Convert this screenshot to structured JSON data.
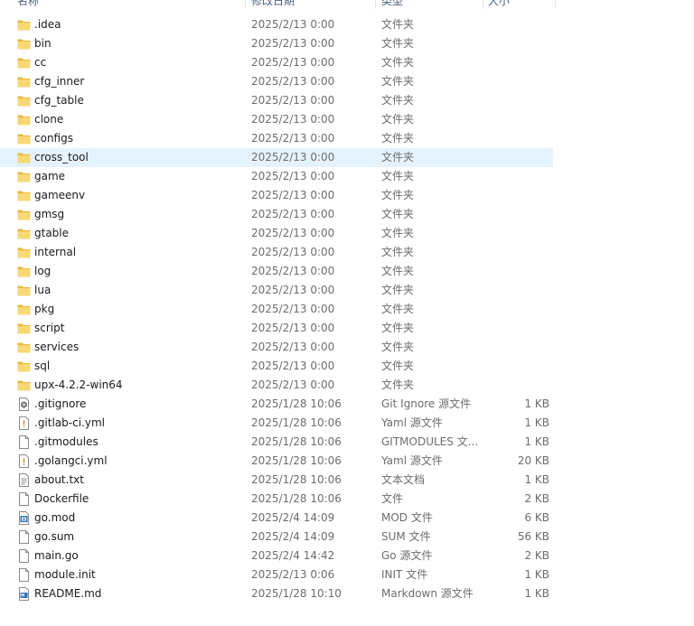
{
  "header": {
    "name": "名称",
    "date": "修改日期",
    "type": "类型",
    "size": "大小"
  },
  "files": [
    {
      "name": ".idea",
      "date": "2025/2/13 0:00",
      "type": "文件夹",
      "size": "",
      "icon": "folder-icon"
    },
    {
      "name": "bin",
      "date": "2025/2/13 0:00",
      "type": "文件夹",
      "size": "",
      "icon": "folder-icon"
    },
    {
      "name": "cc",
      "date": "2025/2/13 0:00",
      "type": "文件夹",
      "size": "",
      "icon": "folder-icon"
    },
    {
      "name": "cfg_inner",
      "date": "2025/2/13 0:00",
      "type": "文件夹",
      "size": "",
      "icon": "folder-icon"
    },
    {
      "name": "cfg_table",
      "date": "2025/2/13 0:00",
      "type": "文件夹",
      "size": "",
      "icon": "folder-icon"
    },
    {
      "name": "clone",
      "date": "2025/2/13 0:00",
      "type": "文件夹",
      "size": "",
      "icon": "folder-icon"
    },
    {
      "name": "configs",
      "date": "2025/2/13 0:00",
      "type": "文件夹",
      "size": "",
      "icon": "folder-icon"
    },
    {
      "name": "cross_tool",
      "date": "2025/2/13 0:00",
      "type": "文件夹",
      "size": "",
      "icon": "folder-icon",
      "hover": true
    },
    {
      "name": "game",
      "date": "2025/2/13 0:00",
      "type": "文件夹",
      "size": "",
      "icon": "folder-icon"
    },
    {
      "name": "gameenv",
      "date": "2025/2/13 0:00",
      "type": "文件夹",
      "size": "",
      "icon": "folder-icon"
    },
    {
      "name": "gmsg",
      "date": "2025/2/13 0:00",
      "type": "文件夹",
      "size": "",
      "icon": "folder-icon"
    },
    {
      "name": "gtable",
      "date": "2025/2/13 0:00",
      "type": "文件夹",
      "size": "",
      "icon": "folder-icon"
    },
    {
      "name": "internal",
      "date": "2025/2/13 0:00",
      "type": "文件夹",
      "size": "",
      "icon": "folder-icon"
    },
    {
      "name": "log",
      "date": "2025/2/13 0:00",
      "type": "文件夹",
      "size": "",
      "icon": "folder-icon"
    },
    {
      "name": "lua",
      "date": "2025/2/13 0:00",
      "type": "文件夹",
      "size": "",
      "icon": "folder-icon"
    },
    {
      "name": "pkg",
      "date": "2025/2/13 0:00",
      "type": "文件夹",
      "size": "",
      "icon": "folder-icon"
    },
    {
      "name": "script",
      "date": "2025/2/13 0:00",
      "type": "文件夹",
      "size": "",
      "icon": "folder-icon"
    },
    {
      "name": "services",
      "date": "2025/2/13 0:00",
      "type": "文件夹",
      "size": "",
      "icon": "folder-icon"
    },
    {
      "name": "sql",
      "date": "2025/2/13 0:00",
      "type": "文件夹",
      "size": "",
      "icon": "folder-icon"
    },
    {
      "name": "upx-4.2.2-win64",
      "date": "2025/2/13 0:00",
      "type": "文件夹",
      "size": "",
      "icon": "folder-icon"
    },
    {
      "name": ".gitignore",
      "date": "2025/1/28 10:06",
      "type": "Git Ignore 源文件",
      "size": "1 KB",
      "icon": "gear-file-icon"
    },
    {
      "name": ".gitlab-ci.yml",
      "date": "2025/1/28 10:06",
      "type": "Yaml 源文件",
      "size": "1 KB",
      "icon": "warning-file-icon"
    },
    {
      "name": ".gitmodules",
      "date": "2025/1/28 10:06",
      "type": "GITMODULES 文...",
      "size": "1 KB",
      "icon": "blank-file-icon"
    },
    {
      "name": ".golangci.yml",
      "date": "2025/1/28 10:06",
      "type": "Yaml 源文件",
      "size": "20 KB",
      "icon": "warning-file-icon"
    },
    {
      "name": "about.txt",
      "date": "2025/1/28 10:06",
      "type": "文本文档",
      "size": "1 KB",
      "icon": "text-file-icon"
    },
    {
      "name": "Dockerfile",
      "date": "2025/1/28 10:06",
      "type": "文件",
      "size": "2 KB",
      "icon": "blank-file-icon"
    },
    {
      "name": "go.mod",
      "date": "2025/2/4 14:09",
      "type": "MOD 文件",
      "size": "6 KB",
      "icon": "mod-file-icon"
    },
    {
      "name": "go.sum",
      "date": "2025/2/4 14:09",
      "type": "SUM 文件",
      "size": "56 KB",
      "icon": "blank-file-icon"
    },
    {
      "name": "main.go",
      "date": "2025/2/4 14:42",
      "type": "Go 源文件",
      "size": "2 KB",
      "icon": "blank-file-icon"
    },
    {
      "name": "module.init",
      "date": "2025/2/13 0:06",
      "type": "INIT 文件",
      "size": "1 KB",
      "icon": "blank-file-icon"
    },
    {
      "name": "README.md",
      "date": "2025/1/28 10:10",
      "type": "Markdown 源文件",
      "size": "1 KB",
      "icon": "markdown-file-icon"
    }
  ],
  "colors": {
    "hover_bg": "#e5f3ff",
    "folder": "#f8d775",
    "folder_dark": "#e8b83a"
  }
}
